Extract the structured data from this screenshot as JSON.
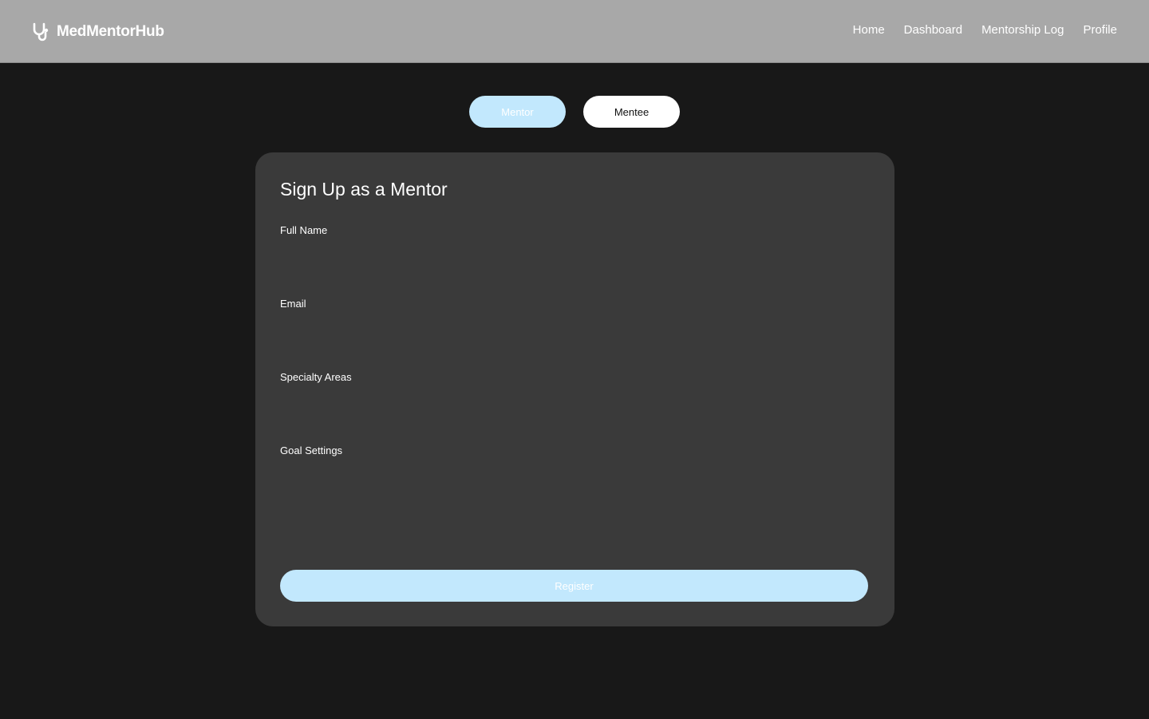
{
  "brand": {
    "name": "MedMentorHub",
    "icon": "stethoscope-icon"
  },
  "nav": {
    "items": [
      {
        "label": "Home"
      },
      {
        "label": "Dashboard"
      },
      {
        "label": "Mentorship Log"
      },
      {
        "label": "Profile"
      }
    ]
  },
  "role_toggle": {
    "mentor_label": "Mentor",
    "mentee_label": "Mentee",
    "selected": "Mentor"
  },
  "form": {
    "title": "Sign Up as a Mentor",
    "fields": {
      "full_name": {
        "label": "Full Name",
        "value": "",
        "placeholder": ""
      },
      "email": {
        "label": "Email",
        "value": "",
        "placeholder": ""
      },
      "specialty": {
        "label": "Specialty Areas",
        "value": "",
        "placeholder": ""
      },
      "goals": {
        "label": "Goal Settings",
        "value": "",
        "placeholder": ""
      }
    },
    "submit_label": "Register"
  },
  "colors": {
    "header_bg": "#a8a8a8",
    "page_bg": "#181818",
    "card_bg": "#3a3a3a",
    "accent": "#c2e8fd"
  }
}
